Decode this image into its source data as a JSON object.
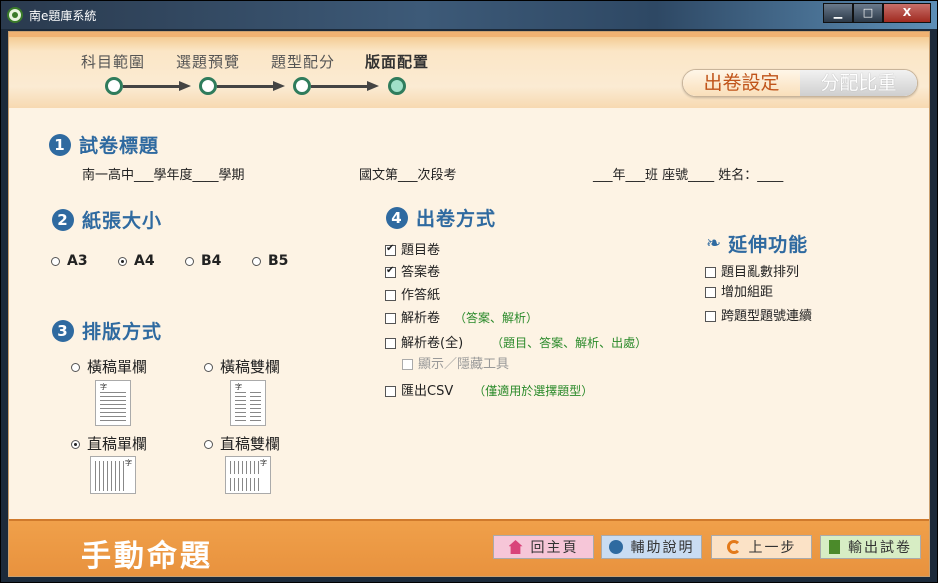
{
  "window": {
    "title": "南e題庫系統",
    "min": "▁",
    "max": "□",
    "close": "X"
  },
  "steps": [
    {
      "label": "科目範圍"
    },
    {
      "label": "選題預覽"
    },
    {
      "label": "題型配分"
    },
    {
      "label": "版面配置"
    }
  ],
  "mode_toggle": {
    "on": "出卷設定",
    "off": "分配比重"
  },
  "section1": {
    "num": "1",
    "title": "試卷標題",
    "line_a": "南一高中___學年度____學期",
    "line_b": "國文第___次段考",
    "line_c": "___年___班 座號____ 姓名：____"
  },
  "section2": {
    "num": "2",
    "title": "紙張大小",
    "options": [
      "A3",
      "A4",
      "B4",
      "B5"
    ],
    "selected": "A4"
  },
  "section3": {
    "num": "3",
    "title": "排版方式",
    "options": [
      "橫稿單欄",
      "橫稿雙欄",
      "直稿單欄",
      "直稿雙欄"
    ],
    "selected": "直稿單欄",
    "thumb_char": "字"
  },
  "section4": {
    "num": "4",
    "title": "出卷方式",
    "items": [
      {
        "label": "題目卷",
        "checked": true,
        "hint": ""
      },
      {
        "label": "答案卷",
        "checked": true,
        "hint": ""
      },
      {
        "label": "作答紙",
        "checked": false,
        "hint": ""
      },
      {
        "label": "解析卷",
        "checked": false,
        "hint": "（答案、解析）"
      },
      {
        "label": "解析卷(全)",
        "checked": false,
        "hint": "（題目、答案、解析、出處）"
      },
      {
        "label": "顯示／隱藏工具",
        "checked": false,
        "hint": "",
        "disabled": true
      },
      {
        "label": "匯出CSV",
        "checked": false,
        "hint": "（僅適用於選擇題型）"
      }
    ]
  },
  "extension": {
    "title": "延伸功能",
    "items": [
      {
        "label": "題目亂數排列",
        "checked": false
      },
      {
        "label": "增加組距",
        "checked": false
      },
      {
        "label": "跨題型題號連續",
        "checked": false
      }
    ]
  },
  "bottom": {
    "title": "手動命題",
    "buttons": [
      {
        "label": "回主頁",
        "icon": "home-icon",
        "color": "#f6c6d8"
      },
      {
        "label": "輔助說明",
        "icon": "speech-bubble-icon",
        "color": "#c9dcf2"
      },
      {
        "label": "上一步",
        "icon": "back-arrow-icon",
        "color": "#fbe2c6"
      },
      {
        "label": "輸出試卷",
        "icon": "document-icon",
        "color": "#d7edc4"
      }
    ]
  },
  "colors": {
    "accent": "#2f6aa0",
    "step": "#2f7c5c",
    "bottom": "#ee9a46",
    "hint": "#2a8a2a"
  }
}
